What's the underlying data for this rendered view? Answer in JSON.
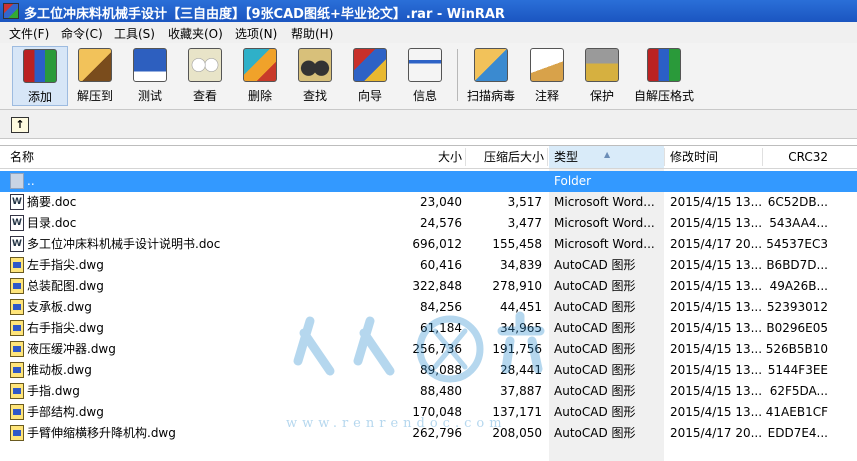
{
  "window": {
    "title": "多工位冲床料机械手设计【三自由度】【9张CAD图纸+毕业论文】.rar - WinRAR"
  },
  "menu": [
    "文件(F)",
    "命令(C)",
    "工具(S)",
    "收藏夹(O)",
    "选项(N)",
    "帮助(H)"
  ],
  "toolbar": {
    "add": "添加",
    "extract": "解压到",
    "test": "测试",
    "view": "查看",
    "delete": "删除",
    "find": "查找",
    "wizard": "向导",
    "info": "信息",
    "virus": "扫描病毒",
    "comment": "注释",
    "protect": "保护",
    "sfx": "自解压格式"
  },
  "columns": {
    "name": "名称",
    "size": "大小",
    "packed": "压缩后大小",
    "type": "类型",
    "modified": "修改时间",
    "crc": "CRC32"
  },
  "files": [
    {
      "name": "..",
      "size": "",
      "packed": "",
      "type": "Folder",
      "modified": "",
      "crc": "",
      "icon": "folder"
    },
    {
      "name": "摘要.doc",
      "size": "23,040",
      "packed": "3,517",
      "type": "Microsoft Word...",
      "modified": "2015/4/15 13...",
      "crc": "6C52DB...",
      "icon": "word"
    },
    {
      "name": "目录.doc",
      "size": "24,576",
      "packed": "3,477",
      "type": "Microsoft Word...",
      "modified": "2015/4/15 13...",
      "crc": "543AA4...",
      "icon": "word"
    },
    {
      "name": "多工位冲床料机械手设计说明书.doc",
      "size": "696,012",
      "packed": "155,458",
      "type": "Microsoft Word...",
      "modified": "2015/4/17 20...",
      "crc": "54537EC3",
      "icon": "word"
    },
    {
      "name": "左手指尖.dwg",
      "size": "60,416",
      "packed": "34,839",
      "type": "AutoCAD 图形",
      "modified": "2015/4/15 13...",
      "crc": "B6BD7D...",
      "icon": "dwg"
    },
    {
      "name": "总装配图.dwg",
      "size": "322,848",
      "packed": "278,910",
      "type": "AutoCAD 图形",
      "modified": "2015/4/15 13...",
      "crc": "49A26B...",
      "icon": "dwg"
    },
    {
      "name": "支承板.dwg",
      "size": "84,256",
      "packed": "44,451",
      "type": "AutoCAD 图形",
      "modified": "2015/4/15 13...",
      "crc": "52393012",
      "icon": "dwg"
    },
    {
      "name": "右手指尖.dwg",
      "size": "61,184",
      "packed": "34,965",
      "type": "AutoCAD 图形",
      "modified": "2015/4/15 13...",
      "crc": "B0296E05",
      "icon": "dwg"
    },
    {
      "name": "液压缓冲器.dwg",
      "size": "256,736",
      "packed": "191,756",
      "type": "AutoCAD 图形",
      "modified": "2015/4/15 13...",
      "crc": "526B5B10",
      "icon": "dwg"
    },
    {
      "name": "推动板.dwg",
      "size": "89,088",
      "packed": "28,441",
      "type": "AutoCAD 图形",
      "modified": "2015/4/15 13...",
      "crc": "5144F3EE",
      "icon": "dwg"
    },
    {
      "name": "手指.dwg",
      "size": "88,480",
      "packed": "37,887",
      "type": "AutoCAD 图形",
      "modified": "2015/4/15 13...",
      "crc": "62F5DA...",
      "icon": "dwg"
    },
    {
      "name": "手部结构.dwg",
      "size": "170,048",
      "packed": "137,171",
      "type": "AutoCAD 图形",
      "modified": "2015/4/15 13...",
      "crc": "41AEB1CF",
      "icon": "dwg"
    },
    {
      "name": "手臂伸缩横移升降机构.dwg",
      "size": "262,796",
      "packed": "208,050",
      "type": "AutoCAD 图形",
      "modified": "2015/4/17 20...",
      "crc": "EDD7E4...",
      "icon": "dwg"
    }
  ],
  "watermark": {
    "url": "www.renrendoc.com"
  },
  "colors": {
    "titlebar": "#1b55c0",
    "selection": "#3399ff",
    "sorted_column": "#f0f0f0"
  }
}
